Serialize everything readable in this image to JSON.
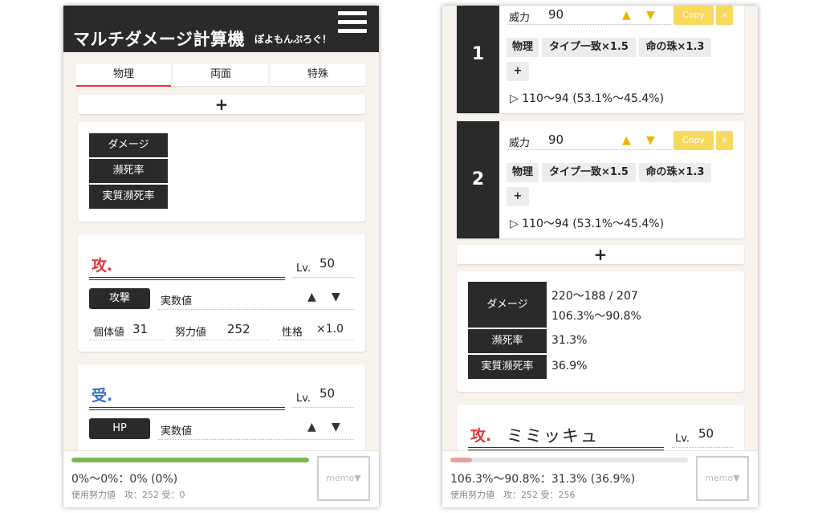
{
  "left": {
    "header": {
      "title": "マルチダメージ計算機",
      "subtitle": "ぽよもんぷろぐ！"
    },
    "tabs": [
      {
        "label": "物理"
      },
      {
        "label": "両面"
      },
      {
        "label": "特殊"
      }
    ],
    "plus": "+",
    "result": {
      "damage": "ダメージ",
      "kill_rate": "瀕死率",
      "real_kill_rate": "実質瀕死率"
    },
    "attacker": {
      "kanji": "攻.",
      "lv_label": "Lv.",
      "lv": "50",
      "stat_button": "攻撃",
      "mode": "実数値",
      "up": "▲",
      "down": "▼",
      "iv_label": "個体値",
      "iv": "31",
      "ev_label": "努力値",
      "ev": "252",
      "nature_label": "性格",
      "nature": "×1.0"
    },
    "defender": {
      "kanji": "受.",
      "lv_label": "Lv.",
      "lv": "50",
      "stat_button": "HP",
      "mode": "実数値",
      "up": "▲",
      "down": "▼"
    },
    "footer": {
      "summary": "0%〜0%：0% (0%)",
      "ev_used": "使用努力値　攻：252 受：0",
      "memo": "memo▼",
      "progress": 1.0,
      "progress_color": "#7cb84f"
    }
  },
  "right": {
    "moves": [
      {
        "number": "1",
        "power_label": "威力",
        "power": "90",
        "up": "▲",
        "down": "▼",
        "copy": "Copy",
        "close": "×",
        "tags": [
          "物理",
          "タイプ一致×1.5",
          "命の珠×1.3"
        ],
        "add": "+",
        "result": "▷ 110〜94 (53.1%〜45.4%)"
      },
      {
        "number": "2",
        "power_label": "威力",
        "power": "90",
        "up": "▲",
        "down": "▼",
        "copy": "Copy",
        "close": "×",
        "tags": [
          "物理",
          "タイプ一致×1.5",
          "命の珠×1.3"
        ],
        "add": "+",
        "result": "▷ 110〜94 (53.1%〜45.4%)"
      }
    ],
    "plus": "+",
    "result": {
      "damage_label": "ダメージ",
      "damage_value1": "220〜188 / 207",
      "damage_value2": "106.3%〜90.8%",
      "kill_label": "瀕死率",
      "kill_value": "31.3%",
      "real_label": "実質瀕死率",
      "real_value": "36.9%"
    },
    "attacker": {
      "kanji": "攻.",
      "name": "ミミッキュ",
      "lv_label": "Lv.",
      "lv": "50"
    },
    "footer": {
      "summary": "106.3%〜90.8%：31.3% (36.9%)",
      "ev_used": "使用努力値　攻：252 受：256",
      "memo": "memo▼",
      "progress": 0.09,
      "progress_color": "#e7a3a3"
    }
  },
  "colors": {
    "dark": "#2a2a2a",
    "accent_red": "#e5333a",
    "accent_blue": "#3a6fc2",
    "gold": "#f6d95d"
  }
}
